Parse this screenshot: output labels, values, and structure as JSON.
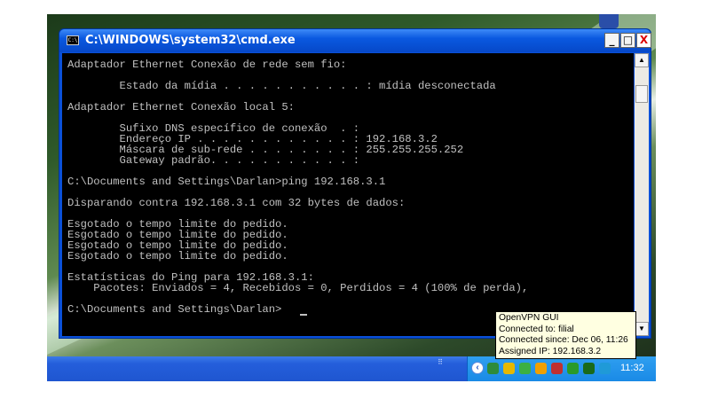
{
  "window": {
    "title": "C:\\WINDOWS\\system32\\cmd.exe",
    "icon": "cmd-icon",
    "icon_text": "C:\\",
    "buttons": {
      "minimize": "_",
      "maximize": "□",
      "close": "X"
    }
  },
  "console": {
    "lines": [
      "Adaptador Ethernet Conexão de rede sem fio:",
      "        Estado da mídia . . . . . . . . . . . : mídia desconectada",
      "Adaptador Ethernet Conexão local 5:",
      "        Sufixo DNS específico de conexão  . :",
      "        Endereço IP . . . . . . . . . . . . : 192.168.3.2",
      "        Máscara de sub-rede . . . . . . . . : 255.255.255.252",
      "        Gateway padrão. . . . . . . . . . . :",
      "C:\\Documents and Settings\\Darlan>ping 192.168.3.1",
      "Disparando contra 192.168.3.1 com 32 bytes de dados:",
      "Esgotado o tempo limite do pedido.",
      "Esgotado o tempo limite do pedido.",
      "Esgotado o tempo limite do pedido.",
      "Esgotado o tempo limite do pedido.",
      "Estatísticas do Ping para 192.168.3.1:",
      "    Pacotes: Enviados = 4, Recebidos = 0, Perdidos = 4 (100% de perda),",
      "C:\\Documents and Settings\\Darlan>"
    ]
  },
  "tooltip": {
    "lines": [
      "OpenVPN GUI",
      "Connected to: filial",
      "Connected since: Dec 06, 11:26",
      "Assigned IP: 192.168.3.2"
    ]
  },
  "taskbar": {
    "clock": "11:32",
    "tray_icons": [
      {
        "name": "network-icon",
        "color": "#2e8b3a"
      },
      {
        "name": "shield-icon",
        "color": "#e6b800"
      },
      {
        "name": "users-icon",
        "color": "#3cb043"
      },
      {
        "name": "messenger-icon",
        "color": "#f0a000"
      },
      {
        "name": "wireless-icon",
        "color": "#c03030"
      },
      {
        "name": "security-check-icon",
        "color": "#2a9a2a"
      },
      {
        "name": "openvpn-icon",
        "color": "#1a6a1a"
      },
      {
        "name": "sync-icon",
        "color": "#1f9ad8"
      }
    ]
  },
  "colors": {
    "console_bg": "#000000",
    "console_text": "#c0c0c0",
    "titlebar": "#0a58e0",
    "tooltip_bg": "#ffffe1"
  }
}
